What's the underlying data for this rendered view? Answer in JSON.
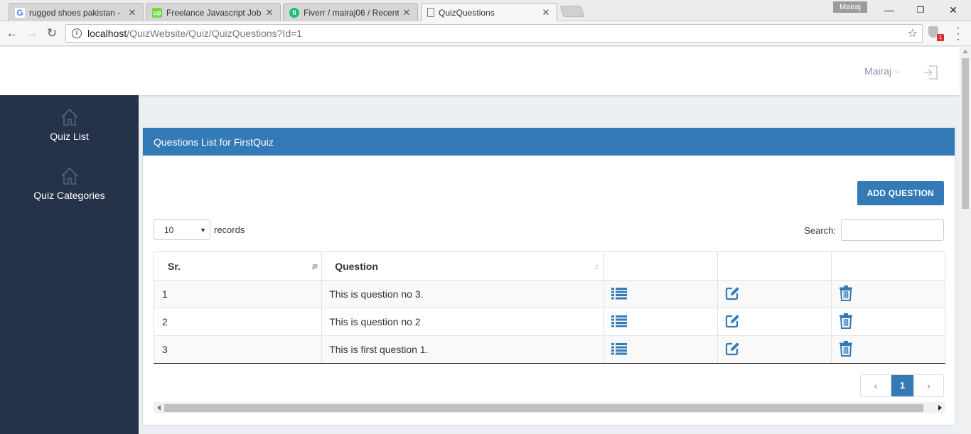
{
  "browser": {
    "tabs": [
      {
        "title": "rugged shoes pakistan -",
        "favicon": "google-icon",
        "active": false
      },
      {
        "title": "Freelance Javascript Jobs",
        "favicon": "upwork-icon",
        "active": false
      },
      {
        "title": "Fiverr / mairaj06 / Recent",
        "favicon": "fiverr-icon",
        "active": false
      },
      {
        "title": "QuizQuestions",
        "favicon": "page-icon",
        "active": true
      }
    ],
    "profile_name": "Mairaj",
    "url_host": "localhost",
    "url_path": "/QuizWebsite/Quiz/QuizQuestions?Id=1",
    "extension_badge": "1"
  },
  "header": {
    "user_name": "Mairaj"
  },
  "sidebar": {
    "items": [
      {
        "label": "Quiz List",
        "icon": "home-icon"
      },
      {
        "label": "Quiz Categories",
        "icon": "home-icon"
      }
    ]
  },
  "panel": {
    "title": "Questions List for FirstQuiz",
    "add_button": "ADD QUESTION",
    "length_value": "10",
    "length_suffix": "records",
    "search_label": "Search:",
    "search_value": ""
  },
  "table": {
    "headers": [
      "Sr.",
      "Question",
      "",
      "",
      ""
    ],
    "rows": [
      {
        "sr": "1",
        "question": "This is question no 3."
      },
      {
        "sr": "2",
        "question": "This is question no 2"
      },
      {
        "sr": "3",
        "question": "This is first question 1."
      }
    ],
    "row_icons": [
      "list-icon",
      "edit-icon",
      "trash-icon"
    ]
  },
  "pagination": {
    "prev": "‹",
    "current": "1",
    "next": "›"
  },
  "colors": {
    "accent": "#337ab7",
    "sidebar": "#24324a",
    "sidebar_icon": "#4f6484"
  }
}
